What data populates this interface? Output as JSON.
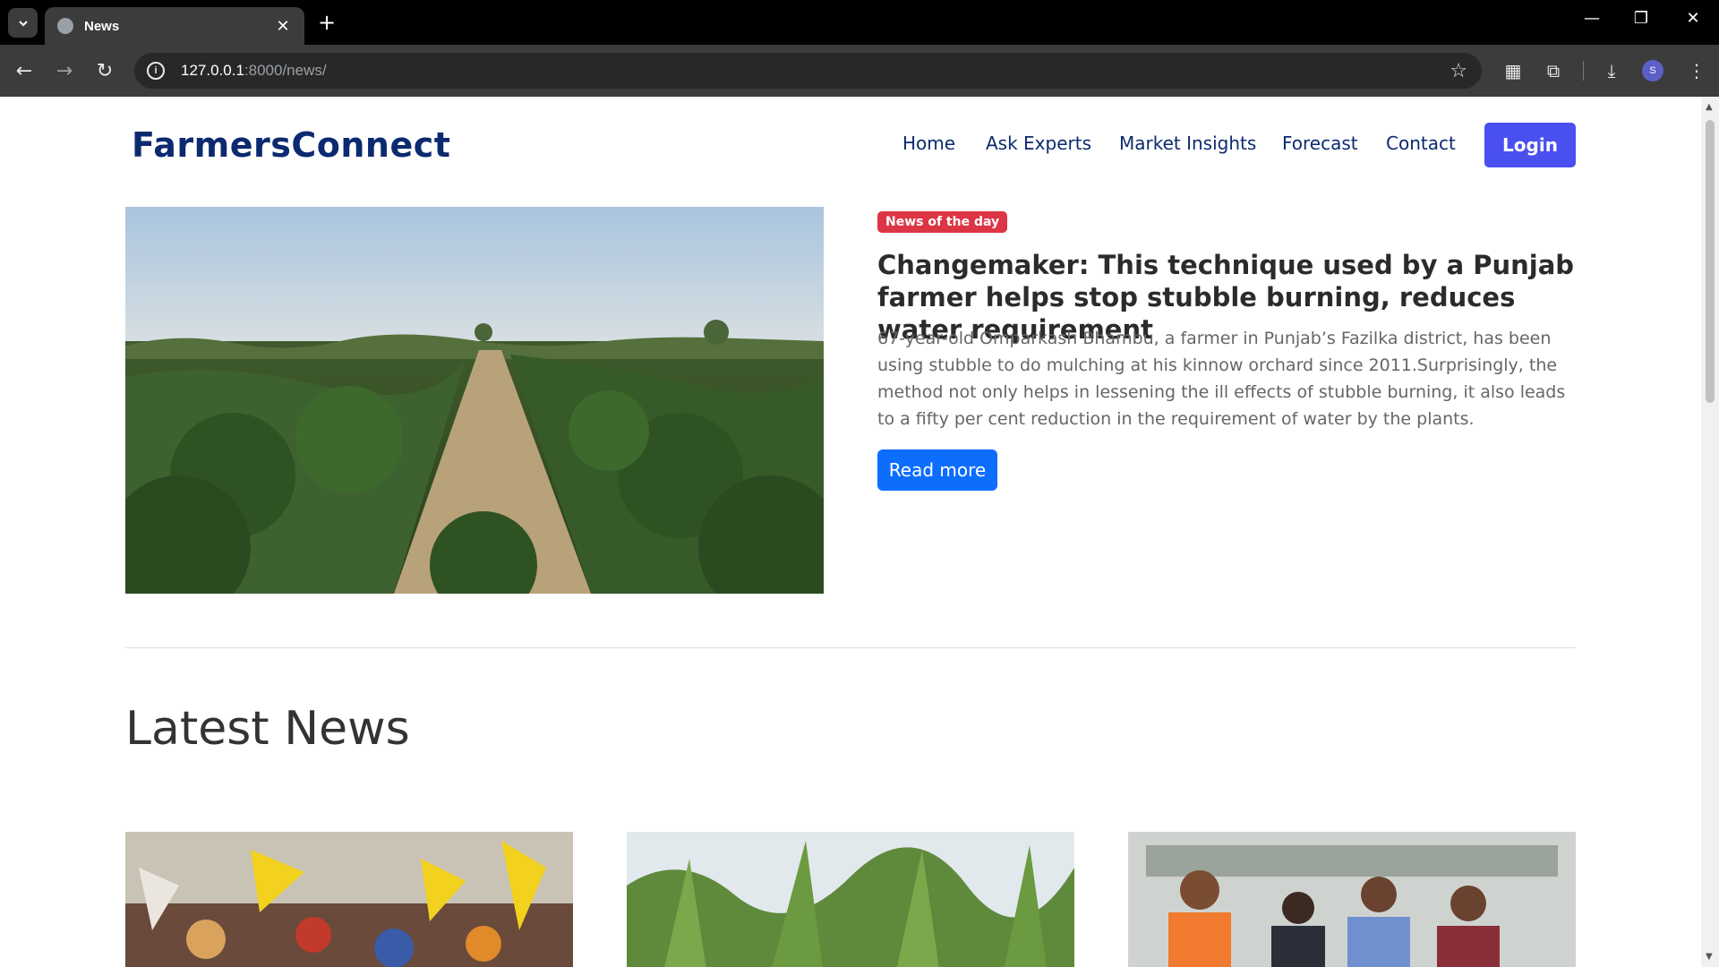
{
  "browser": {
    "tab_title": "News",
    "url_host": "127.0.0.1",
    "url_rest": ":8000/news/",
    "profile_initial": "S"
  },
  "site": {
    "brand": "FarmersConnect",
    "nav": [
      "Home",
      "Ask Experts",
      "Market Insights",
      "Forecast",
      "Contact"
    ],
    "login_label": "Login"
  },
  "featured": {
    "badge": "News of the day",
    "title": "Changemaker: This technique used by a Punjab farmer helps stop stubble burning, reduces water requirement",
    "description": "67-year-old Omparkash Bhambu, a farmer in Punjab’s Fazilka district, has been using stubble to do mulching at his kinnow orchard since 2011.Surprisingly, the method not only helps in lessening the ill effects of stubble burning, it also leads to a fifty per cent reduction in the requirement of water by the plants.",
    "read_more": "Read more"
  },
  "latest": {
    "heading": "Latest News"
  },
  "colors": {
    "brand": "#0b2a6f",
    "login_bg": "#4a4ff0",
    "badge_bg": "#dc3545",
    "read_more_bg": "#0d6efd"
  }
}
